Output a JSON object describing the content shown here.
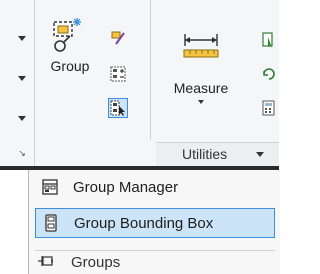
{
  "ribbon": {
    "group_panel": {
      "group_button_label": "Group",
      "small_buttons": [
        {
          "icon": "ungroup-icon"
        },
        {
          "icon": "group-edit-icon"
        },
        {
          "icon": "group-selection-toggle-icon",
          "active": true
        }
      ]
    },
    "utilities_panel": {
      "measure_button_label": "Measure",
      "title": "Utilities"
    }
  },
  "groups_menu": {
    "items": [
      {
        "label": "Group Manager",
        "icon": "group-manager-icon",
        "selected": false
      },
      {
        "label": "Group Bounding Box",
        "icon": "group-bounding-box-icon",
        "selected": true
      }
    ],
    "footer_label": "Groups"
  },
  "colors": {
    "ribbon_bg": "#f5f6f7",
    "selection_bg": "#cce4f7",
    "selection_border": "#3d8ee0",
    "ribbon_edge": "#2a2a2a"
  }
}
